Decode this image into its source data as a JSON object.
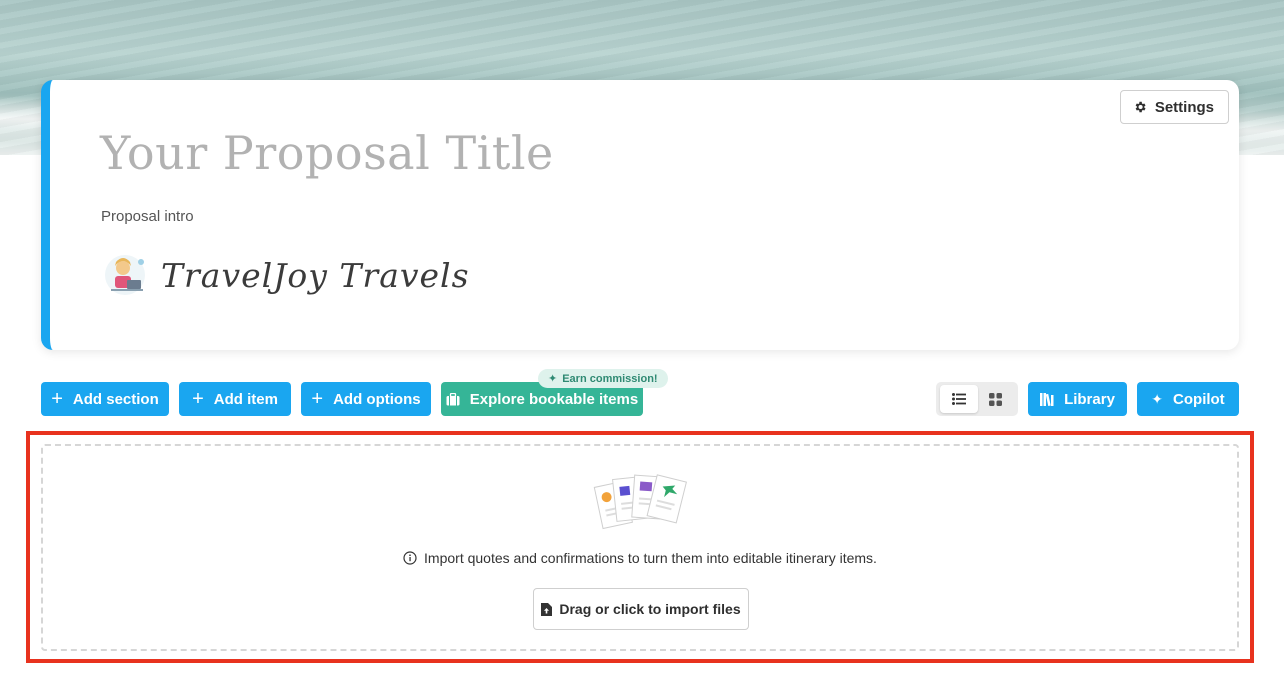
{
  "header": {
    "settings_label": "Settings",
    "title_placeholder": "Your Proposal Title",
    "intro_placeholder": "Proposal intro",
    "brand_name": "TravelJoy Travels"
  },
  "toolbar": {
    "add_section": "Add section",
    "add_item": "Add item",
    "add_options": "Add options",
    "explore_bookable": "Explore bookable items",
    "earn_badge": "Earn commission!",
    "library": "Library",
    "copilot": "Copilot",
    "view_modes": [
      "list-view",
      "grid-view"
    ],
    "active_view": "list-view"
  },
  "import": {
    "info_text": "Import quotes and confirmations to turn them into editable itinerary items.",
    "button_label": "Drag or click to import files"
  },
  "colors": {
    "primary": "#1aa6f0",
    "green": "#35b597",
    "highlight": "#e8321e"
  }
}
